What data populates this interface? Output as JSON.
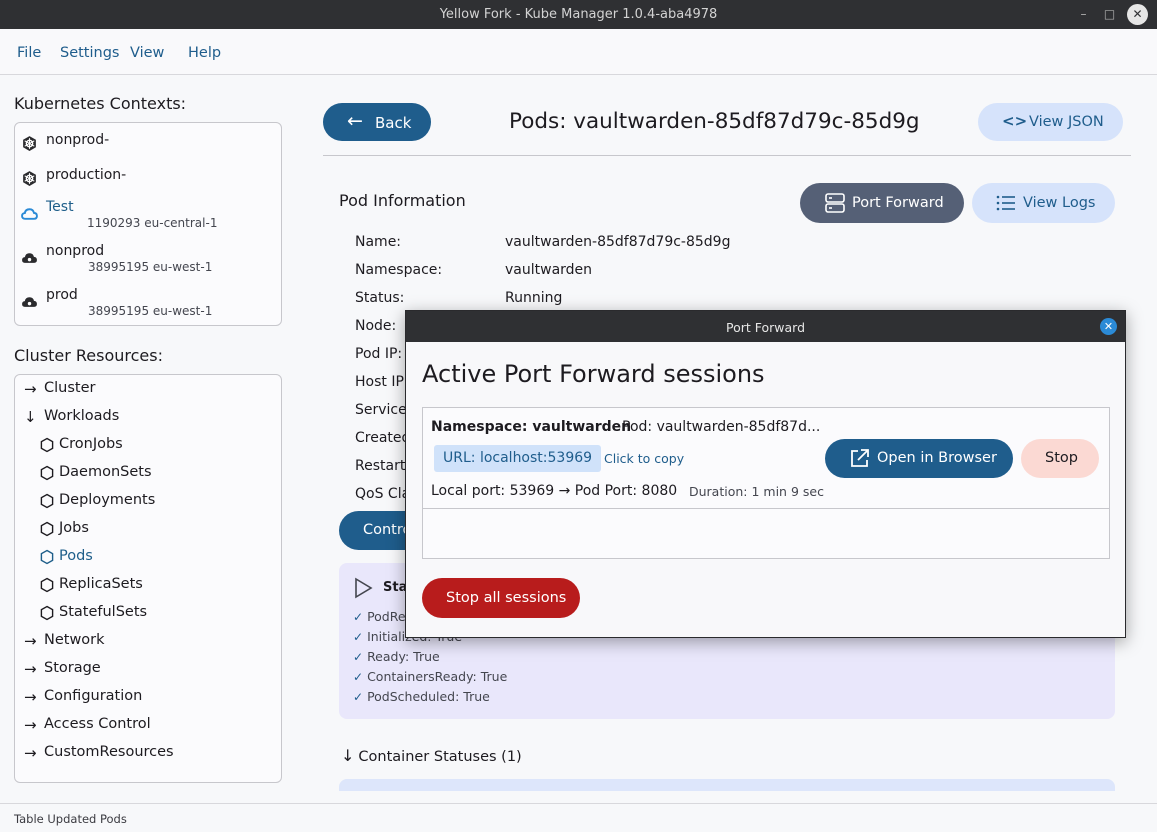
{
  "window": {
    "title": "Yellow Fork - Kube Manager 1.0.4-aba4978",
    "minimize": "–",
    "maximize": "□",
    "close": "✕"
  },
  "menu": [
    "File",
    "Settings",
    "View",
    "Help"
  ],
  "contexts": {
    "heading": "Kubernetes Contexts:",
    "items": [
      {
        "name": "nonprod-",
        "sub": "",
        "icon": "kubernetes-icon",
        "active": false
      },
      {
        "name": "production-",
        "sub": "",
        "icon": "kubernetes-icon",
        "active": false
      },
      {
        "name": "Test",
        "sub": "1190293 eu-central-1",
        "icon": "cloud-icon",
        "active": true
      },
      {
        "name": "nonprod",
        "sub": "38995195 eu-west-1",
        "icon": "cloud-icon",
        "active": false
      },
      {
        "name": "prod",
        "sub": "38995195 eu-west-1",
        "icon": "cloud-icon",
        "active": false
      }
    ]
  },
  "resources": {
    "heading": "Cluster Resources:",
    "items": [
      {
        "label": "Cluster",
        "level": 0,
        "arrow": "→"
      },
      {
        "label": "Workloads",
        "level": 0,
        "arrow": "↓"
      },
      {
        "label": "CronJobs",
        "level": 1
      },
      {
        "label": "DaemonSets",
        "level": 1
      },
      {
        "label": "Deployments",
        "level": 1
      },
      {
        "label": "Jobs",
        "level": 1
      },
      {
        "label": "Pods",
        "level": 1,
        "active": true
      },
      {
        "label": "ReplicaSets",
        "level": 1
      },
      {
        "label": "StatefulSets",
        "level": 1
      },
      {
        "label": "Network",
        "level": 0,
        "arrow": "→"
      },
      {
        "label": "Storage",
        "level": 0,
        "arrow": "→"
      },
      {
        "label": "Configuration",
        "level": 0,
        "arrow": "→"
      },
      {
        "label": "Access Control",
        "level": 0,
        "arrow": "→"
      },
      {
        "label": "CustomResources",
        "level": 0,
        "arrow": "→"
      }
    ]
  },
  "status_bar": "Table Updated Pods",
  "header": {
    "back": "Back",
    "back_icon": "←",
    "title": "Pods: vaultwarden-85df87d79c-85d9g",
    "view_json": "View JSON",
    "json_icon": "<>"
  },
  "pod_info": {
    "heading": "Pod Information",
    "port_forward": "Port Forward",
    "view_logs": "View Logs",
    "fields": [
      {
        "label": "Name:",
        "value": "vaultwarden-85df87d79c-85d9g"
      },
      {
        "label": "Namespace:",
        "value": "vaultwarden"
      },
      {
        "label": "Status:",
        "value": "Running"
      },
      {
        "label": "Node:",
        "value": ""
      },
      {
        "label": "Pod IP:",
        "value": ""
      },
      {
        "label": "Host IP:",
        "value": ""
      },
      {
        "label": "Service",
        "value": ""
      },
      {
        "label": "Created",
        "value": ""
      },
      {
        "label": "Restarts",
        "value": ""
      },
      {
        "label": "QoS Cla",
        "value": ""
      }
    ],
    "controls": "Contro"
  },
  "conditions": {
    "title": "Stat",
    "items": [
      "PodRe",
      "Initialized: True",
      "Ready: True",
      "ContainersReady: True",
      "PodScheduled: True"
    ],
    "check": "✓",
    "play_icon": "▷"
  },
  "container_statuses": {
    "label": "Container Statuses (1)",
    "arrow": "↓"
  },
  "dialog": {
    "title": "Port Forward",
    "close": "✕",
    "heading": "Active Port Forward sessions",
    "session": {
      "namespace": "Namespace: vaultwarden",
      "pod": "Pod: vaultwarden-85df87d...",
      "url": "URL: localhost:53969",
      "copy": "Click to copy",
      "ports": "Local port: 53969 → Pod Port: 8080",
      "duration": "Duration: 1 min 9 sec",
      "open": "Open in Browser",
      "stop": "Stop"
    },
    "stop_all": "Stop all sessions"
  },
  "colors": {
    "primary": "#1f5d8c",
    "tonal": "#d6e3fb",
    "slate": "#556076",
    "danger": "#b81c1c",
    "stop": "#fbd9d3",
    "conditions_bg": "#e9e7fb"
  }
}
